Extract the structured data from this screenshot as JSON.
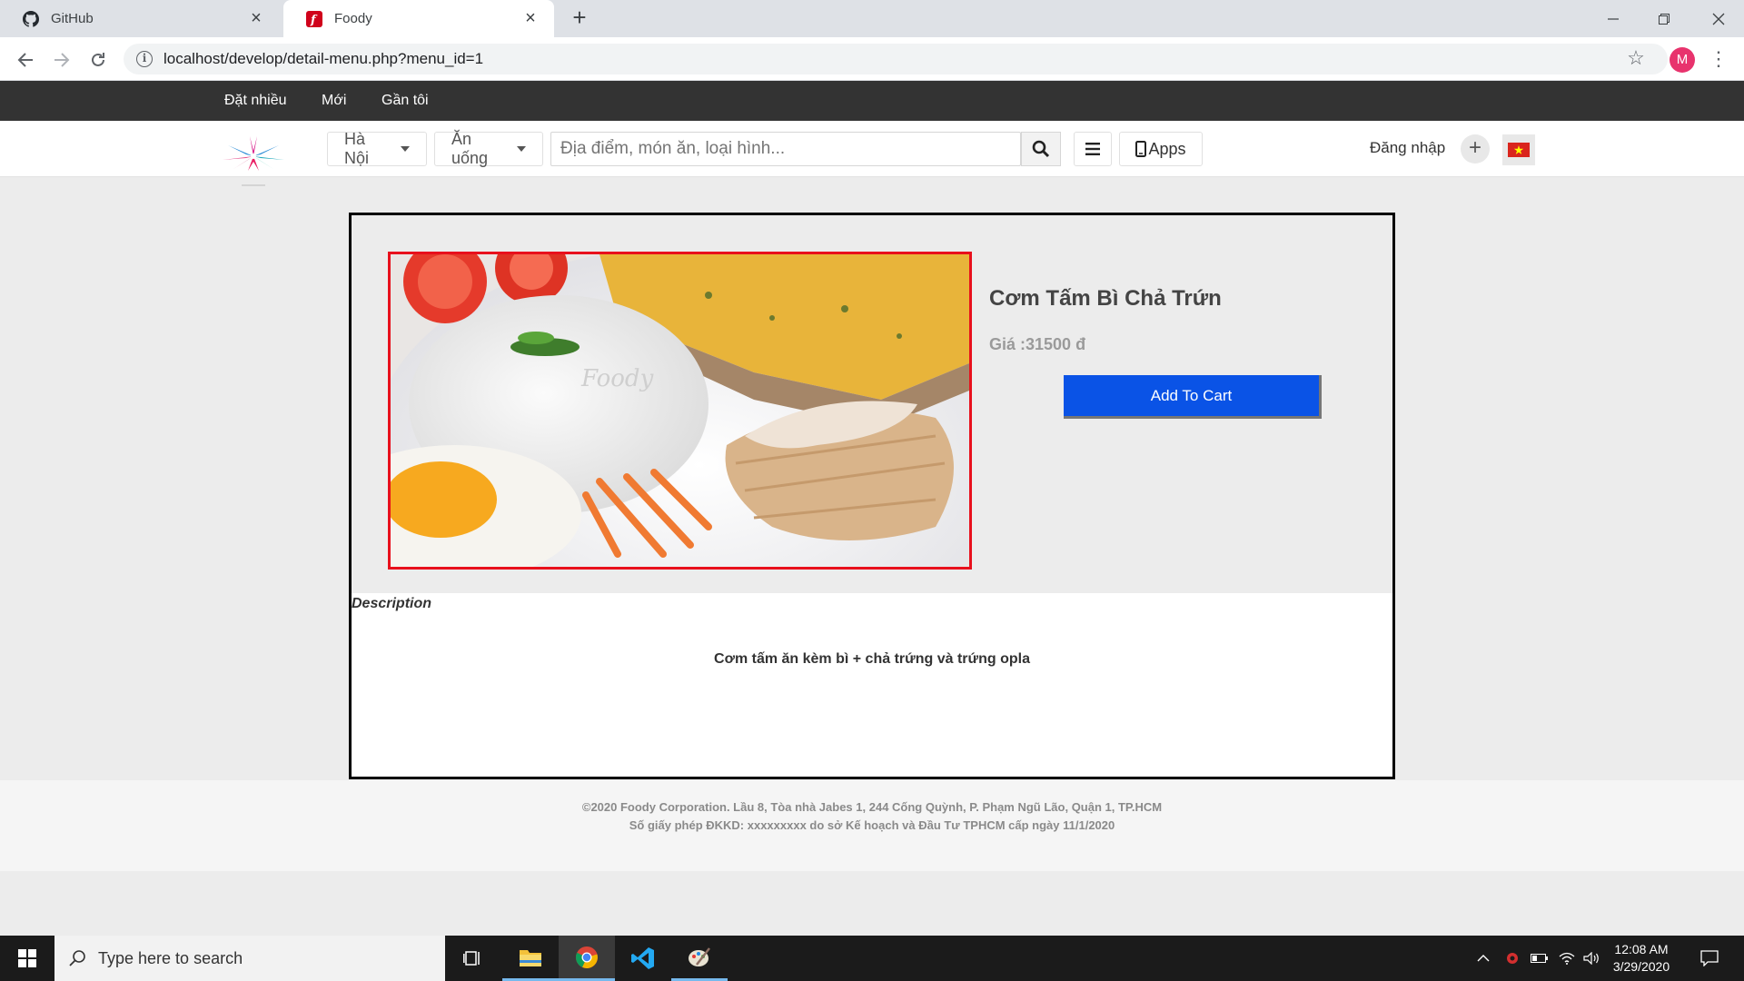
{
  "browser": {
    "tabs": [
      {
        "title": "GitHub"
      },
      {
        "title": "Foody"
      }
    ],
    "url": "localhost/develop/detail-menu.php?menu_id=1"
  },
  "site": {
    "top_nav": [
      "Đặt nhiều",
      "Mới",
      "Gần tôi"
    ],
    "city": "Hà Nội",
    "category": "Ăn uống",
    "search_placeholder": "Địa điểm, món ăn, loại hình...",
    "apps_label": "Apps",
    "login_label": "Đăng nhập"
  },
  "product": {
    "name": "Cơm Tấm Bì Chả Trứn",
    "price": "Giá :31500 đ",
    "add_to_cart": "Add To Cart",
    "description_label": "Description",
    "description": "Cơm tấm ăn kèm bì + chả trứng và trứng opla",
    "image_watermark": "Foody"
  },
  "footer": {
    "line1": "©2020 Foody Corporation. Lầu 8, Tòa nhà Jabes 1, 244 Cống Quỳnh, P. Phạm Ngũ Lão, Quận 1, TP.HCM",
    "line2": "Số giấy phép ĐKKD: xxxxxxxxx do sở Kế hoạch và Đầu Tư TPHCM cấp ngày 11/1/2020"
  },
  "taskbar": {
    "search_placeholder": "Type here to search",
    "time": "12:08 AM",
    "date": "3/29/2020"
  },
  "colors": {
    "topbar": "#333333",
    "cart_button": "#0a53e6",
    "image_border": "#e8101c"
  }
}
